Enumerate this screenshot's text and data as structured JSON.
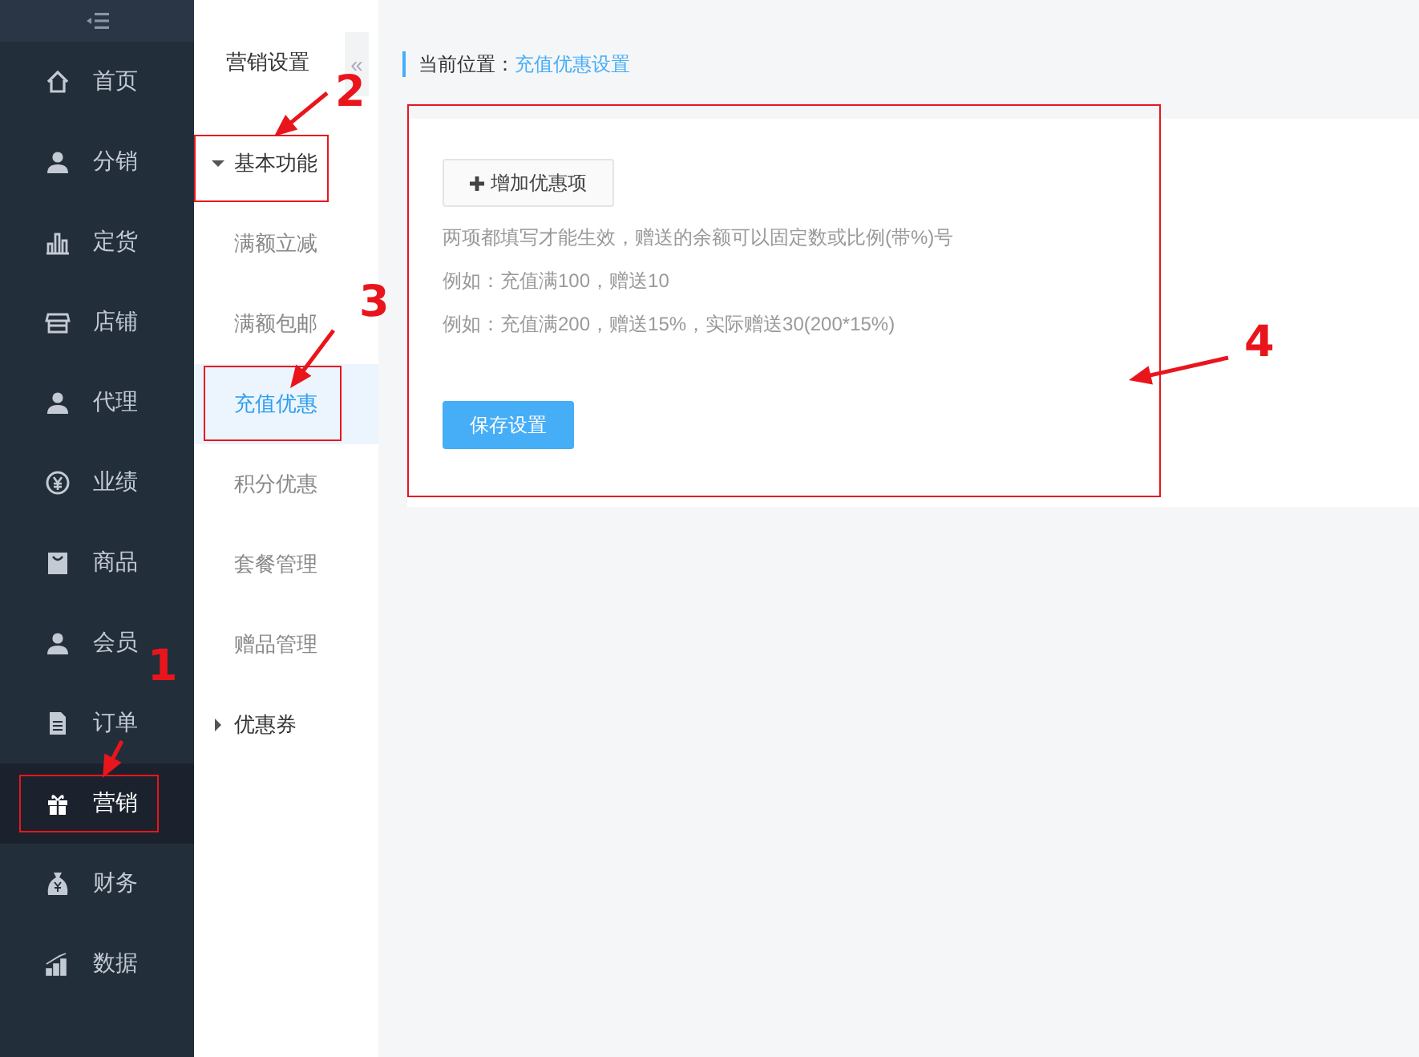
{
  "sidebar": {
    "items": [
      {
        "label": "首页",
        "selected": false
      },
      {
        "label": "分销",
        "selected": false
      },
      {
        "label": "定货",
        "selected": false
      },
      {
        "label": "店铺",
        "selected": false
      },
      {
        "label": "代理",
        "selected": false
      },
      {
        "label": "业绩",
        "selected": false
      },
      {
        "label": "商品",
        "selected": false
      },
      {
        "label": "会员",
        "selected": false
      },
      {
        "label": "订单",
        "selected": false
      },
      {
        "label": "营销",
        "selected": true
      },
      {
        "label": "财务",
        "selected": false
      },
      {
        "label": "数据",
        "selected": false
      }
    ]
  },
  "submenu": {
    "title": "营销设置",
    "collapse_glyph": "«",
    "groups": [
      {
        "label": "基本功能",
        "expanded": true,
        "children": [
          {
            "label": "满额立减",
            "selected": false
          },
          {
            "label": "满额包邮",
            "selected": false
          },
          {
            "label": "充值优惠",
            "selected": true
          },
          {
            "label": "积分优惠",
            "selected": false
          },
          {
            "label": "套餐管理",
            "selected": false
          },
          {
            "label": "赠品管理",
            "selected": false
          }
        ]
      },
      {
        "label": "优惠券",
        "expanded": false
      }
    ]
  },
  "breadcrumb": {
    "label": "当前位置：",
    "current": "充值优惠设置"
  },
  "card": {
    "add_button": "增加优惠项",
    "notes": [
      "两项都填写才能生效，赠送的余额可以固定数或比例(带%)号",
      "例如：充值满100，赠送10",
      "例如：充值满200，赠送15%，实际赠送30(200*15%)"
    ],
    "save_button": "保存设置"
  },
  "annotations": [
    {
      "label": "1"
    },
    {
      "label": "2"
    },
    {
      "label": "3"
    },
    {
      "label": "4"
    }
  ]
}
